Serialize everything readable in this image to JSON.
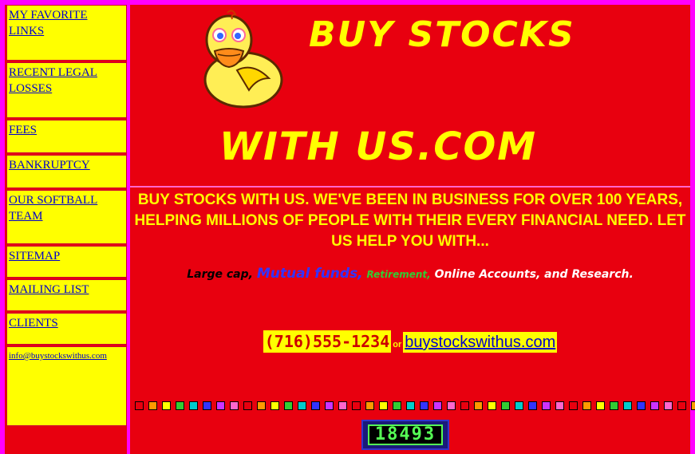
{
  "sidebar": {
    "items": [
      {
        "label": "MY FAVORITE LINKS"
      },
      {
        "label": "RECENT LEGAL LOSSES"
      },
      {
        "label": "FEES"
      },
      {
        "label": "BANKRUPTCY"
      },
      {
        "label": "OUR SOFTBALL TEAM"
      },
      {
        "label": "SITEMAP"
      },
      {
        "label": "MAILING LIST"
      },
      {
        "label": "CLIENTS"
      },
      {
        "label": "info@buystockswithus.com"
      }
    ]
  },
  "header": {
    "title_line1": "BUY STOCKS",
    "title_line2": "WITH US.COM",
    "logo_icon": "duck-logo-icon"
  },
  "intro": {
    "text": "BUY STOCKS WITH US. WE'VE BEEN IN BUSINESS FOR OVER 100 YEARS, HELPING MILLIONS OF PEOPLE WITH THEIR EVERY FINANCIAL NEED. LET US HELP YOU WITH..."
  },
  "services": {
    "large_cap": "Large cap,",
    "mutual_funds": "Mutual funds,",
    "retirement": "Retirement,",
    "rest": "Online Accounts, and Research."
  },
  "contact": {
    "phone": "(716)555-1234",
    "or": "or",
    "site": "buystockswithus.com"
  },
  "counter": {
    "value": "18493"
  },
  "colors": {
    "background": "#e8000f",
    "frame": "#ff00ff",
    "accent": "#ffff00",
    "link": "#0000cc",
    "dots": [
      "#e8000f",
      "#ff9900",
      "#ffff00",
      "#33cc33",
      "#00cccc",
      "#3333ff",
      "#cc33ff",
      "#ff66cc"
    ]
  }
}
